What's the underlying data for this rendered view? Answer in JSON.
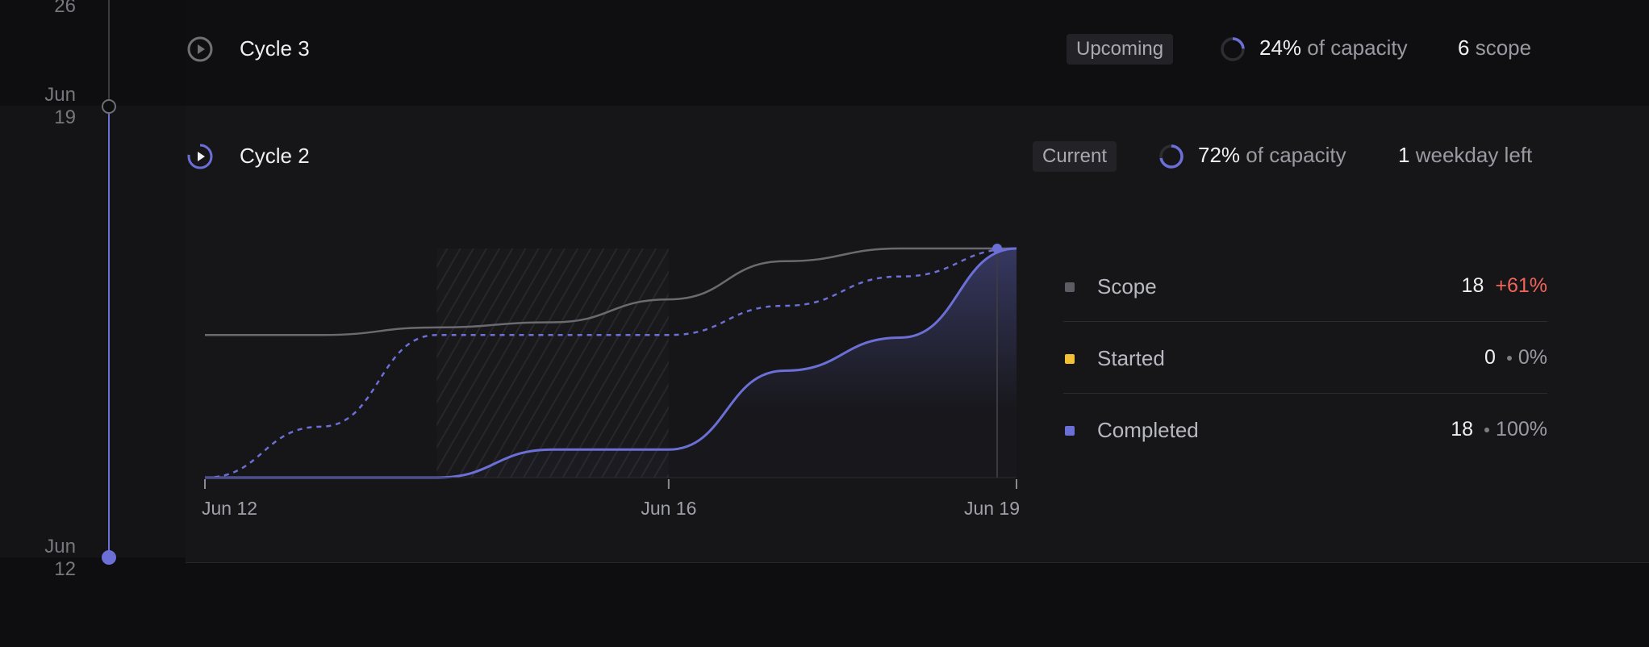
{
  "timeline": {
    "top_partial_label": "26",
    "date_upper": [
      "Jun",
      "19"
    ],
    "date_lower": [
      "Jun",
      "12"
    ]
  },
  "cycles": [
    {
      "name": "Cycle 3",
      "status": "Upcoming",
      "capacity_pct": "24%",
      "capacity_label": "of capacity",
      "capacity_fraction": 0.24,
      "count": "6",
      "count_label": "scope"
    },
    {
      "name": "Cycle 2",
      "status": "Current",
      "capacity_pct": "72%",
      "capacity_label": "of capacity",
      "capacity_fraction": 0.72,
      "count": "1",
      "count_label": "weekday left"
    }
  ],
  "legend": [
    {
      "label": "Scope",
      "value": "18",
      "delta": "+61%",
      "color": "#5c5c62"
    },
    {
      "label": "Started",
      "value": "0",
      "delta": "0%",
      "color": "#f2c037"
    },
    {
      "label": "Completed",
      "value": "18",
      "delta": "100%",
      "color": "#6b6fd6"
    }
  ],
  "colors": {
    "accent": "#6b6fd6",
    "scope_line": "#6a6a70",
    "delta_red": "#f0645a"
  },
  "chart_data": {
    "type": "area",
    "x": [
      "Jun 12",
      "Jun 13",
      "Jun 14",
      "Jun 15",
      "Jun 16",
      "Jun 17",
      "Jun 18",
      "Jun 19"
    ],
    "x_ticks": [
      "Jun 12",
      "Jun 16",
      "Jun 19"
    ],
    "weekend_shaded": [
      "Jun 14",
      "Jun 15"
    ],
    "ylim": [
      0,
      18
    ],
    "grid": false,
    "series": [
      {
        "name": "Scope",
        "line": "solid",
        "values": [
          11.2,
          11.2,
          11.8,
          12.2,
          14.0,
          17.0,
          18.0,
          18.0
        ]
      },
      {
        "name": "Started",
        "line": "dashed",
        "values": [
          0,
          4.0,
          11.2,
          11.2,
          11.2,
          13.5,
          15.8,
          18.0
        ]
      },
      {
        "name": "Completed",
        "line": "solid-fill",
        "values": [
          0,
          0,
          0,
          2.2,
          2.2,
          8.4,
          11.0,
          18.0
        ]
      }
    ]
  }
}
